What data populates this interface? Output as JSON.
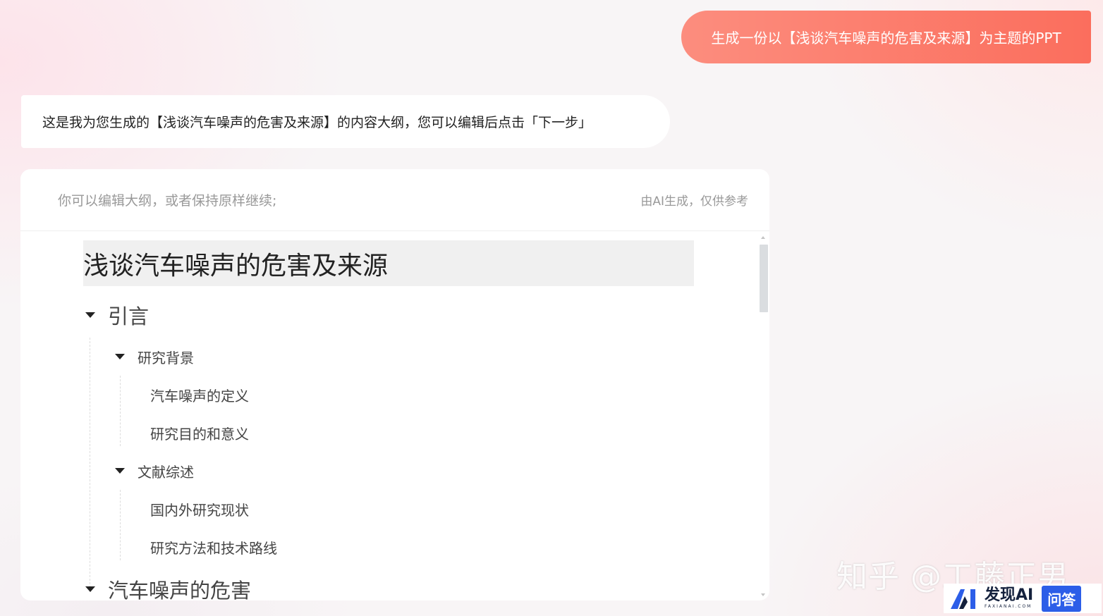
{
  "user_message": "生成一份以【浅谈汽车噪声的危害及来源】为主题的PPT",
  "assistant_message": "这是我为您生成的【浅谈汽车噪声的危害及来源】的内容大纲，您可以编辑后点击「下一步」",
  "card": {
    "hint": "你可以编辑大纲，或者保持原样继续;",
    "disclaimer": "由AI生成，仅供参考"
  },
  "outline": {
    "title": "浅谈汽车噪声的危害及来源",
    "sections": [
      {
        "label": "引言",
        "subsections": [
          {
            "label": "研究背景",
            "items": [
              "汽车噪声的定义",
              "研究目的和意义"
            ]
          },
          {
            "label": "文献综述",
            "items": [
              "国内外研究现状",
              "研究方法和技术路线"
            ]
          }
        ]
      },
      {
        "label": "汽车噪声的危害"
      }
    ]
  },
  "watermark": "知乎 @工藤正男",
  "brand": {
    "name": "发现AI",
    "sub": "FAXIANAI.COM",
    "tag": "问答"
  },
  "colors": {
    "accent_start": "#fc8d7e",
    "accent_end": "#fb6e5d",
    "brand_blue": "#2c5ee8"
  }
}
